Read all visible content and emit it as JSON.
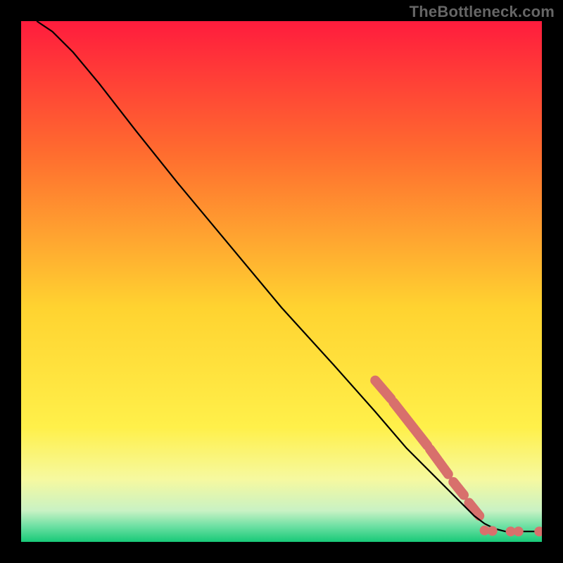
{
  "watermark": "TheBottleneck.com",
  "chart_data": {
    "type": "line",
    "title": "",
    "xlabel": "",
    "ylabel": "",
    "xlim": [
      0,
      100
    ],
    "ylim": [
      0,
      100
    ],
    "grid": false,
    "legend": false,
    "background_gradient": {
      "stops": [
        {
          "offset": 0.0,
          "color": "#ff1c3d"
        },
        {
          "offset": 0.25,
          "color": "#ff6b2f"
        },
        {
          "offset": 0.55,
          "color": "#ffd330"
        },
        {
          "offset": 0.78,
          "color": "#fff04a"
        },
        {
          "offset": 0.88,
          "color": "#f6f9a0"
        },
        {
          "offset": 0.94,
          "color": "#c9f2c4"
        },
        {
          "offset": 0.97,
          "color": "#6de0a3"
        },
        {
          "offset": 1.0,
          "color": "#18c978"
        }
      ]
    },
    "series": [
      {
        "name": "curve",
        "type": "line",
        "color": "#000000",
        "x": [
          3,
          6,
          10,
          15,
          22,
          30,
          40,
          50,
          60,
          68,
          74,
          80,
          84,
          87,
          89,
          91,
          93,
          96,
          100
        ],
        "y": [
          100,
          98,
          94,
          88,
          79,
          69,
          57,
          45,
          34,
          25,
          18,
          12,
          8,
          5,
          3.5,
          2.5,
          2,
          2,
          2
        ]
      },
      {
        "name": "thick-pink-segments",
        "type": "line",
        "color": "#d8706c",
        "stroke_width": 14,
        "segments": [
          {
            "x": [
              68,
              71
            ],
            "y": [
              31,
              27.5
            ]
          },
          {
            "x": [
              71.5,
              78
            ],
            "y": [
              26.8,
              18.5
            ]
          },
          {
            "x": [
              78.5,
              82
            ],
            "y": [
              17.8,
              13
            ]
          },
          {
            "x": [
              83,
              85
            ],
            "y": [
              11.5,
              9
            ]
          },
          {
            "x": [
              86,
              88
            ],
            "y": [
              7.5,
              5
            ]
          }
        ]
      },
      {
        "name": "bottom-dots",
        "type": "scatter",
        "color": "#d8706c",
        "radius": 7,
        "x": [
          89,
          90.5,
          94,
          95.5,
          99.5
        ],
        "y": [
          2.2,
          2.1,
          2.0,
          2.0,
          2.0
        ]
      }
    ]
  }
}
